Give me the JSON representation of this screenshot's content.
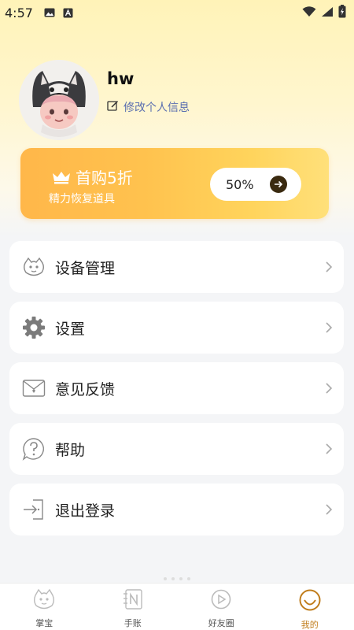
{
  "status_bar": {
    "time": "4:57",
    "icons": [
      "image-icon",
      "a-letter-icon",
      "wifi-icon",
      "signal-icon",
      "battery-charging-icon"
    ]
  },
  "profile": {
    "username": "hw",
    "edit_label": "修改个人信息"
  },
  "promo": {
    "title": "首购5折",
    "subtitle": "精力恢复道具",
    "button_label": "50%"
  },
  "menu": [
    {
      "label": "设备管理",
      "icon": "device-icon"
    },
    {
      "label": "设置",
      "icon": "gear-icon"
    },
    {
      "label": "意见反馈",
      "icon": "envelope-icon"
    },
    {
      "label": "帮助",
      "icon": "help-icon"
    },
    {
      "label": "退出登录",
      "icon": "logout-icon"
    }
  ],
  "nav": [
    {
      "label": "掌宝",
      "icon": "pet-icon",
      "active": false
    },
    {
      "label": "手账",
      "icon": "notebook-icon",
      "active": false
    },
    {
      "label": "好友圈",
      "icon": "friends-circle-icon",
      "active": false
    },
    {
      "label": "我的",
      "icon": "me-icon",
      "active": true
    }
  ],
  "colors": {
    "accent": "#c07d1c",
    "promo_start": "#ffb74a",
    "promo_end": "#ffe07a",
    "link": "#5b6fb0"
  }
}
